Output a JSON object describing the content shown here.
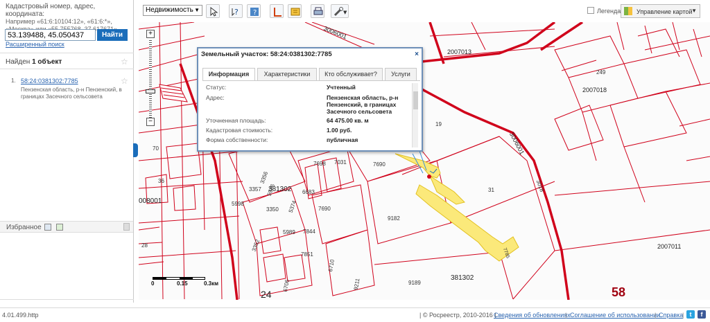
{
  "left_panel": {
    "hint_title": "Кадастровый номер, адрес, координата:",
    "hint_example": "Например «61:6:10104:12», «61:6:*», «Москва» или «55.755768, 37.617671»",
    "search_value": "53.139488, 45.050437",
    "find_label": "Найти",
    "advanced_search": "Расширенный поиск",
    "found_prefix": "Найден",
    "found_count": "1 объект",
    "result_number": "1.",
    "result_cadastral": "58:24:0381302:7785",
    "result_address": "Пензенская область, р-н Пензенский, в границах Засечного сельсовета",
    "favorites_label": "Избранное"
  },
  "toolbar": {
    "realty_select": "Недвижимость",
    "legend_label": "Легенда",
    "map_management": "Управление картой",
    "icons": [
      "select-icon",
      "identify-icon",
      "info-icon",
      "measure-icon",
      "layers-icon",
      "print-icon",
      "tools-icon"
    ]
  },
  "map": {
    "labels": {
      "l_3006001_top": "3006001",
      "l_2007013": "2007013",
      "l_2007018": "2007018",
      "l_249": "249",
      "l_3006001_r": "3006001",
      "l_19": "19",
      "l_7690a": "7690",
      "l_7690b": "7690",
      "l_7698": "7698",
      "l_7031": "7031",
      "l_381302a": "381302",
      "l_381302b": "381302",
      "l_31": "31",
      "l_9182": "9182",
      "l_3018": "3018",
      "l_2007011": "2007011",
      "l_7785": "7785",
      "l_9189": "9189",
      "l_9211": "9211",
      "l_7844": "7844",
      "l_7851": "7851",
      "l_6710": "6710",
      "l_6706": "6706",
      "l_3350": "3350",
      "l_5989": "5989",
      "l_3352": "3352",
      "l_3356": "3356",
      "l_3357": "3357",
      "l_5998": "5998",
      "l_6683": "6683",
      "l_008001": "008001",
      "l_70": "70",
      "l_36": "36",
      "l_28": "28",
      "l_24": "24",
      "l_58": "58",
      "l_5976": "5976",
      "l_5374": "5374"
    },
    "scale": {
      "zero": "0",
      "mid": "0.15",
      "end": "0.3км"
    },
    "colors": {
      "boundary": "#d0021b",
      "parcel": "#f5e142",
      "parcel_fill": "#fbe97a"
    }
  },
  "popup": {
    "title": "Земельный участок: 58:24:0381302:7785",
    "close": "×",
    "tabs": [
      "Информация",
      "Характеристики",
      "Кто обслуживает?",
      "Услуги"
    ],
    "rows": [
      {
        "label": "Статус:",
        "value": "Учтенный"
      },
      {
        "label": "Адрес:",
        "value": "Пензенская область, р-н Пензенский, в границах Засечного сельсовета"
      },
      {
        "label": "Уточненная площадь:",
        "value": "64 475.00 кв. м"
      },
      {
        "label": "Кадастровая стоимость:",
        "value": "1.00 руб."
      },
      {
        "label": "Форма собственности:",
        "value": "публичная"
      }
    ]
  },
  "footer": {
    "version": "4.01.499.http",
    "copyright": "| © Росреестр, 2010-2016 |",
    "updates": "Сведения об обновлениях",
    "terms": "Соглашение об использовании",
    "help": "Справка"
  }
}
